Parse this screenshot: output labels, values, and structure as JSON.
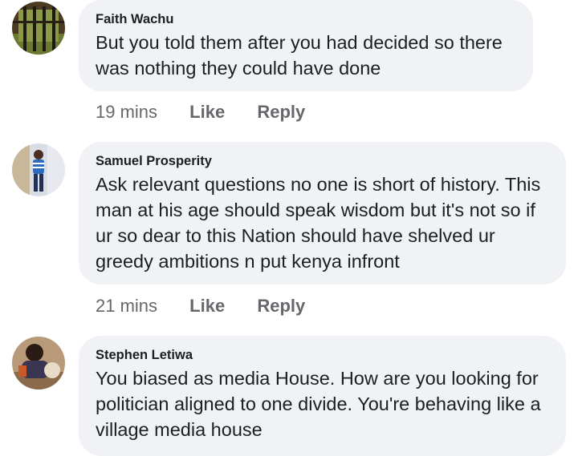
{
  "comments": [
    {
      "author": "Faith Wachu",
      "text": "But you told them after you had decided so there was nothing they could have done",
      "time": "19 mins",
      "like_label": "Like",
      "reply_label": "Reply"
    },
    {
      "author": "Samuel Prosperity",
      "text": "Ask relevant questions no one is short of history. This man at his age should speak wisdom but it's not so if ur so dear to this Nation should have shelved ur greedy ambitions n put kenya infront",
      "time": "21 mins",
      "like_label": "Like",
      "reply_label": "Reply"
    },
    {
      "author": "Stephen Letiwa",
      "text": "You biased as media House. How are you looking for politician aligned to one divide. You're behaving like a village media house"
    }
  ],
  "colors": {
    "bubble": "#f0f2f5",
    "text": "#1c1e21",
    "meta": "#65676b"
  }
}
